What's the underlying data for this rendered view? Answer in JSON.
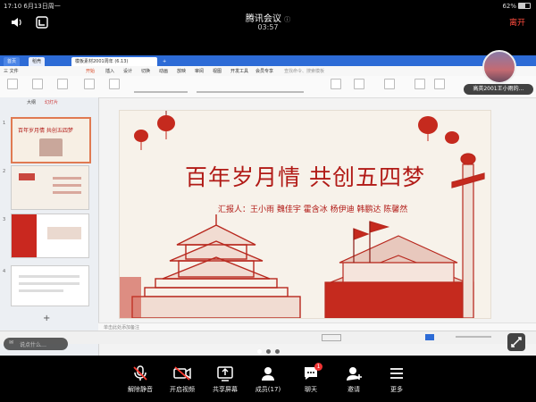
{
  "status_bar": {
    "time_date": "17:10  6月13日周一",
    "battery": "62%"
  },
  "meeting": {
    "title": "腾讯会议",
    "timer": "03:57",
    "leave_label": "离开"
  },
  "app": {
    "tabs": [
      "首页",
      "稻壳",
      "模板素材2001周年 (6.13)"
    ],
    "menus": [
      "三 文件",
      "开始",
      "插入",
      "设计",
      "切换",
      "动画",
      "放映",
      "审阅",
      "视图",
      "开发工具",
      "会员专享"
    ],
    "search_placeholder": "查找命令、搜索模板"
  },
  "thumbnail_panel": {
    "tabs": [
      "大纲",
      "幻灯片"
    ],
    "numbers": [
      "1",
      "2",
      "3",
      "4"
    ]
  },
  "slide": {
    "title": "百年岁月情  共创五四梦",
    "reporters": "汇报人：王小雨 魏佳宇 霍含冰 杨伊迪 韩鹏达 陈馨然"
  },
  "notes_placeholder": "单击此处添加备注",
  "chat_hint": "说点什么…",
  "speaker": {
    "name": "高英2001王小雨的…"
  },
  "toolbar": {
    "mute": "解除静音",
    "video": "开启视频",
    "share": "共享屏幕",
    "members": "成员(17)",
    "chat": "聊天",
    "chat_badge": "1",
    "invite": "邀请",
    "more": "更多"
  },
  "colors": {
    "accent_red": "#b11a16",
    "leave_red": "#ff4b3e",
    "tab_blue": "#2d6bd6"
  }
}
